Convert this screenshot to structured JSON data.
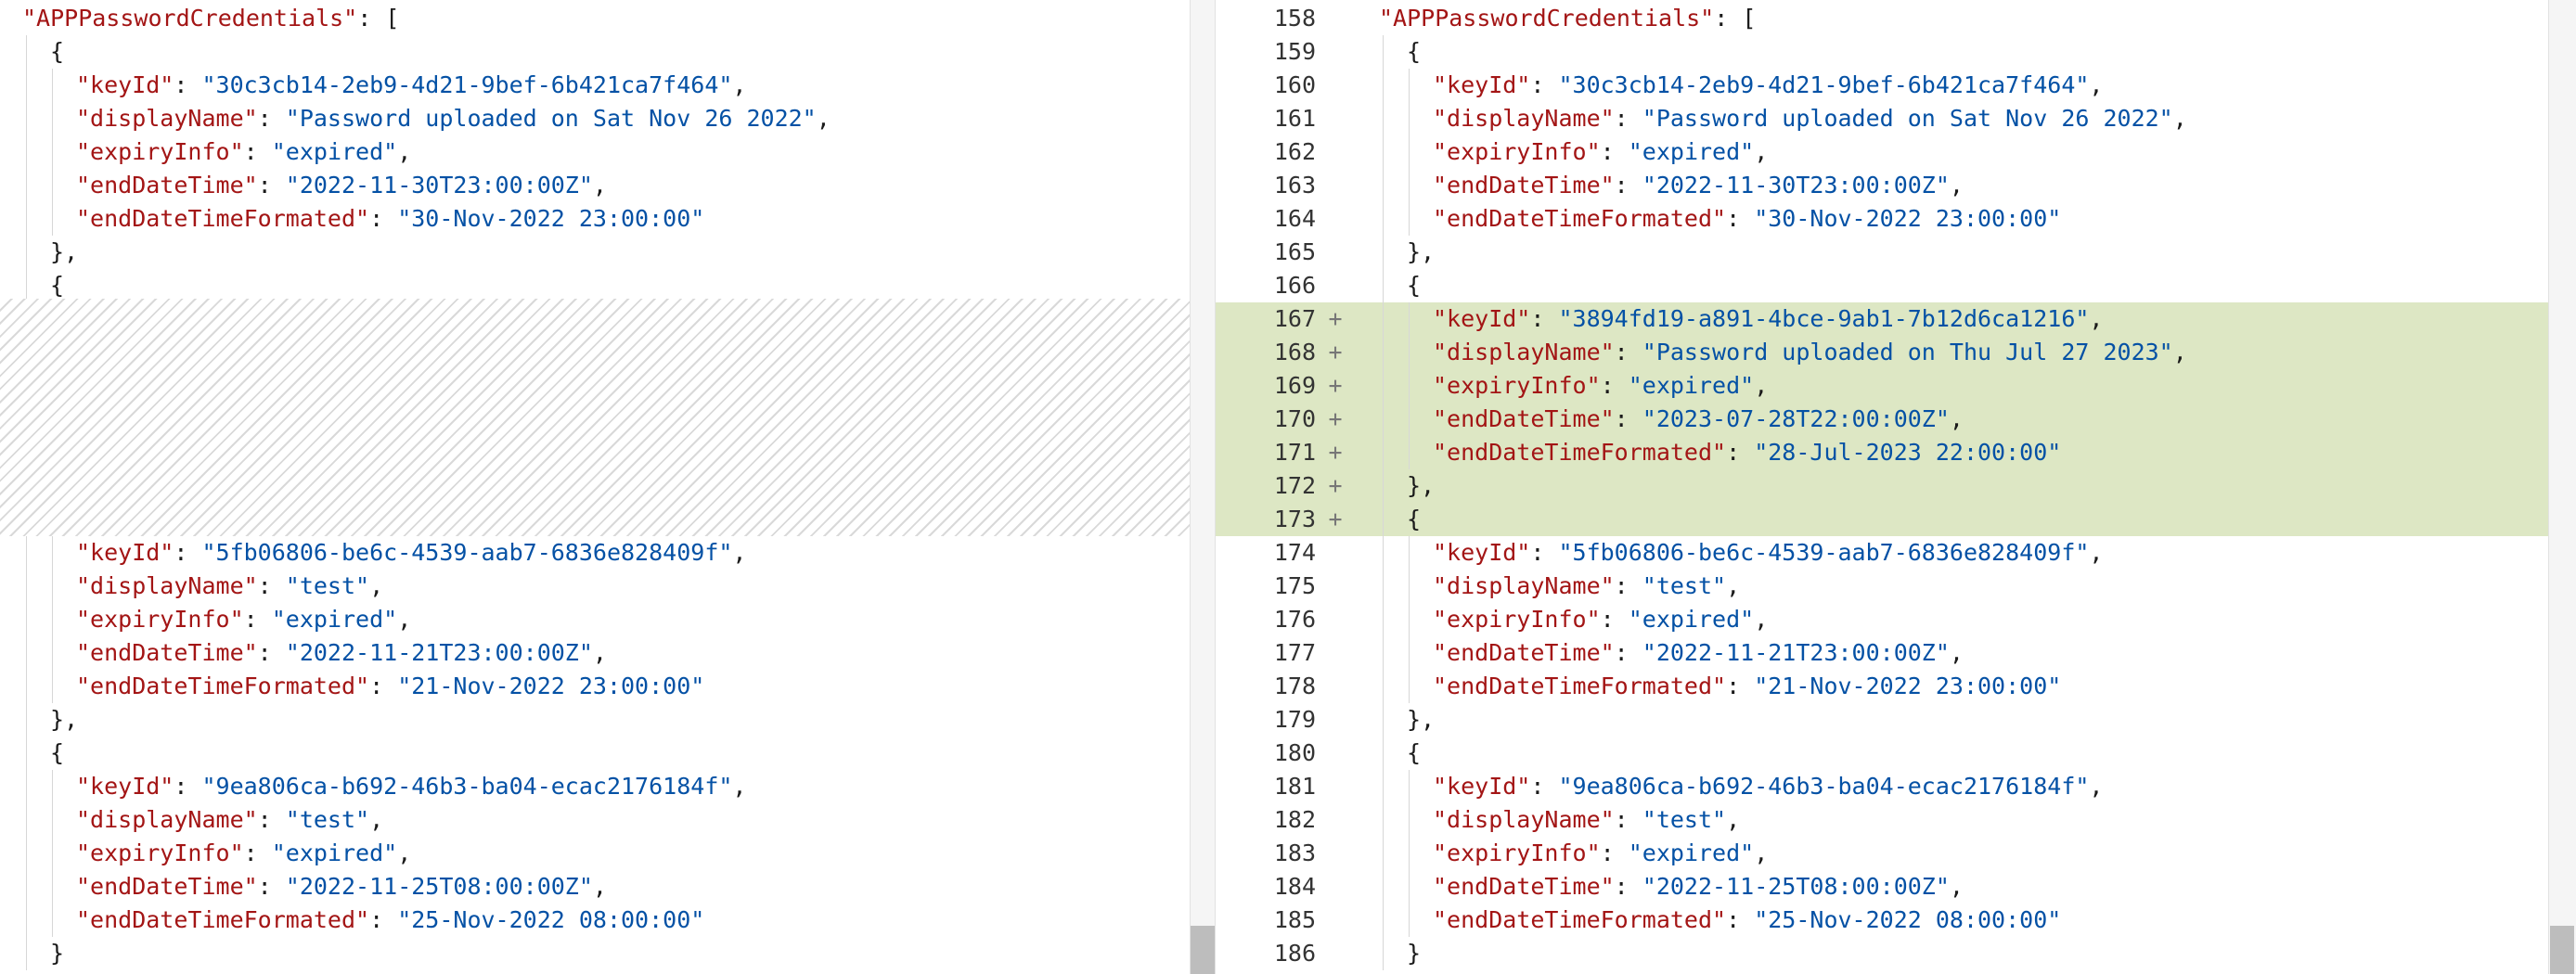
{
  "left": {
    "lines": [
      {
        "type": "key",
        "text": "\"APPPasswordCredentials\"",
        "rest": ": ["
      },
      {
        "type": "brace",
        "text": "{"
      },
      {
        "type": "pair",
        "key": "\"keyId\"",
        "val": "\"30c3cb14-2eb9-4d21-9bef-6b421ca7f464\"",
        "tail": ","
      },
      {
        "type": "pair",
        "key": "\"displayName\"",
        "val": "\"Password uploaded on Sat Nov 26 2022\"",
        "tail": ","
      },
      {
        "type": "pair",
        "key": "\"expiryInfo\"",
        "val": "\"expired\"",
        "tail": ","
      },
      {
        "type": "pair",
        "key": "\"endDateTime\"",
        "val": "\"2022-11-30T23:00:00Z\"",
        "tail": ","
      },
      {
        "type": "pair",
        "key": "\"endDateTimeFormated\"",
        "val": "\"30-Nov-2022 23:00:00\"",
        "tail": ""
      },
      {
        "type": "brace",
        "text": "},"
      },
      {
        "type": "brace",
        "text": "{"
      },
      {
        "type": "gap"
      },
      {
        "type": "gap"
      },
      {
        "type": "gap"
      },
      {
        "type": "gap"
      },
      {
        "type": "gap"
      },
      {
        "type": "gap"
      },
      {
        "type": "gap"
      },
      {
        "type": "pair",
        "key": "\"keyId\"",
        "val": "\"5fb06806-be6c-4539-aab7-6836e828409f\"",
        "tail": ","
      },
      {
        "type": "pair",
        "key": "\"displayName\"",
        "val": "\"test\"",
        "tail": ","
      },
      {
        "type": "pair",
        "key": "\"expiryInfo\"",
        "val": "\"expired\"",
        "tail": ","
      },
      {
        "type": "pair",
        "key": "\"endDateTime\"",
        "val": "\"2022-11-21T23:00:00Z\"",
        "tail": ","
      },
      {
        "type": "pair",
        "key": "\"endDateTimeFormated\"",
        "val": "\"21-Nov-2022 23:00:00\"",
        "tail": ""
      },
      {
        "type": "brace",
        "text": "},"
      },
      {
        "type": "brace",
        "text": "{"
      },
      {
        "type": "pair",
        "key": "\"keyId\"",
        "val": "\"9ea806ca-b692-46b3-ba04-ecac2176184f\"",
        "tail": ","
      },
      {
        "type": "pair",
        "key": "\"displayName\"",
        "val": "\"test\"",
        "tail": ","
      },
      {
        "type": "pair",
        "key": "\"expiryInfo\"",
        "val": "\"expired\"",
        "tail": ","
      },
      {
        "type": "pair",
        "key": "\"endDateTime\"",
        "val": "\"2022-11-25T08:00:00Z\"",
        "tail": ","
      },
      {
        "type": "pair",
        "key": "\"endDateTimeFormated\"",
        "val": "\"25-Nov-2022 08:00:00\"",
        "tail": ""
      },
      {
        "type": "brace",
        "text": "}"
      }
    ]
  },
  "right": {
    "lines": [
      {
        "n": "158",
        "mark": "",
        "type": "key",
        "text": "\"APPPasswordCredentials\"",
        "rest": ": ["
      },
      {
        "n": "159",
        "mark": "",
        "type": "brace",
        "text": "{"
      },
      {
        "n": "160",
        "mark": "",
        "type": "pair",
        "key": "\"keyId\"",
        "val": "\"30c3cb14-2eb9-4d21-9bef-6b421ca7f464\"",
        "tail": ","
      },
      {
        "n": "161",
        "mark": "",
        "type": "pair",
        "key": "\"displayName\"",
        "val": "\"Password uploaded on Sat Nov 26 2022\"",
        "tail": ","
      },
      {
        "n": "162",
        "mark": "",
        "type": "pair",
        "key": "\"expiryInfo\"",
        "val": "\"expired\"",
        "tail": ","
      },
      {
        "n": "163",
        "mark": "",
        "type": "pair",
        "key": "\"endDateTime\"",
        "val": "\"2022-11-30T23:00:00Z\"",
        "tail": ","
      },
      {
        "n": "164",
        "mark": "",
        "type": "pair",
        "key": "\"endDateTimeFormated\"",
        "val": "\"30-Nov-2022 23:00:00\"",
        "tail": ""
      },
      {
        "n": "165",
        "mark": "",
        "type": "brace",
        "text": "},"
      },
      {
        "n": "166",
        "mark": "",
        "type": "brace",
        "text": "{"
      },
      {
        "n": "167",
        "mark": "+",
        "type": "pair",
        "key": "\"keyId\"",
        "val": "\"3894fd19-a891-4bce-9ab1-7b12d6ca1216\"",
        "tail": ","
      },
      {
        "n": "168",
        "mark": "+",
        "type": "pair",
        "key": "\"displayName\"",
        "val": "\"Password uploaded on Thu Jul 27 2023\"",
        "tail": ","
      },
      {
        "n": "169",
        "mark": "+",
        "type": "pair",
        "key": "\"expiryInfo\"",
        "val": "\"expired\"",
        "tail": ","
      },
      {
        "n": "170",
        "mark": "+",
        "type": "pair",
        "key": "\"endDateTime\"",
        "val": "\"2023-07-28T22:00:00Z\"",
        "tail": ","
      },
      {
        "n": "171",
        "mark": "+",
        "type": "pair",
        "key": "\"endDateTimeFormated\"",
        "val": "\"28-Jul-2023 22:00:00\"",
        "tail": ""
      },
      {
        "n": "172",
        "mark": "+",
        "type": "brace",
        "text": "},"
      },
      {
        "n": "173",
        "mark": "+",
        "type": "brace",
        "text": "{"
      },
      {
        "n": "174",
        "mark": "",
        "type": "pair",
        "key": "\"keyId\"",
        "val": "\"5fb06806-be6c-4539-aab7-6836e828409f\"",
        "tail": ","
      },
      {
        "n": "175",
        "mark": "",
        "type": "pair",
        "key": "\"displayName\"",
        "val": "\"test\"",
        "tail": ","
      },
      {
        "n": "176",
        "mark": "",
        "type": "pair",
        "key": "\"expiryInfo\"",
        "val": "\"expired\"",
        "tail": ","
      },
      {
        "n": "177",
        "mark": "",
        "type": "pair",
        "key": "\"endDateTime\"",
        "val": "\"2022-11-21T23:00:00Z\"",
        "tail": ","
      },
      {
        "n": "178",
        "mark": "",
        "type": "pair",
        "key": "\"endDateTimeFormated\"",
        "val": "\"21-Nov-2022 23:00:00\"",
        "tail": ""
      },
      {
        "n": "179",
        "mark": "",
        "type": "brace",
        "text": "},"
      },
      {
        "n": "180",
        "mark": "",
        "type": "brace",
        "text": "{"
      },
      {
        "n": "181",
        "mark": "",
        "type": "pair",
        "key": "\"keyId\"",
        "val": "\"9ea806ca-b692-46b3-ba04-ecac2176184f\"",
        "tail": ","
      },
      {
        "n": "182",
        "mark": "",
        "type": "pair",
        "key": "\"displayName\"",
        "val": "\"test\"",
        "tail": ","
      },
      {
        "n": "183",
        "mark": "",
        "type": "pair",
        "key": "\"expiryInfo\"",
        "val": "\"expired\"",
        "tail": ","
      },
      {
        "n": "184",
        "mark": "",
        "type": "pair",
        "key": "\"endDateTime\"",
        "val": "\"2022-11-25T08:00:00Z\"",
        "tail": ","
      },
      {
        "n": "185",
        "mark": "",
        "type": "pair",
        "key": "\"endDateTimeFormated\"",
        "val": "\"25-Nov-2022 08:00:00\"",
        "tail": ""
      },
      {
        "n": "186",
        "mark": "",
        "type": "brace",
        "text": "}"
      }
    ]
  },
  "colors": {
    "key": "#a31515",
    "string": "#0451a5",
    "added_bg": "#dde7c4"
  }
}
